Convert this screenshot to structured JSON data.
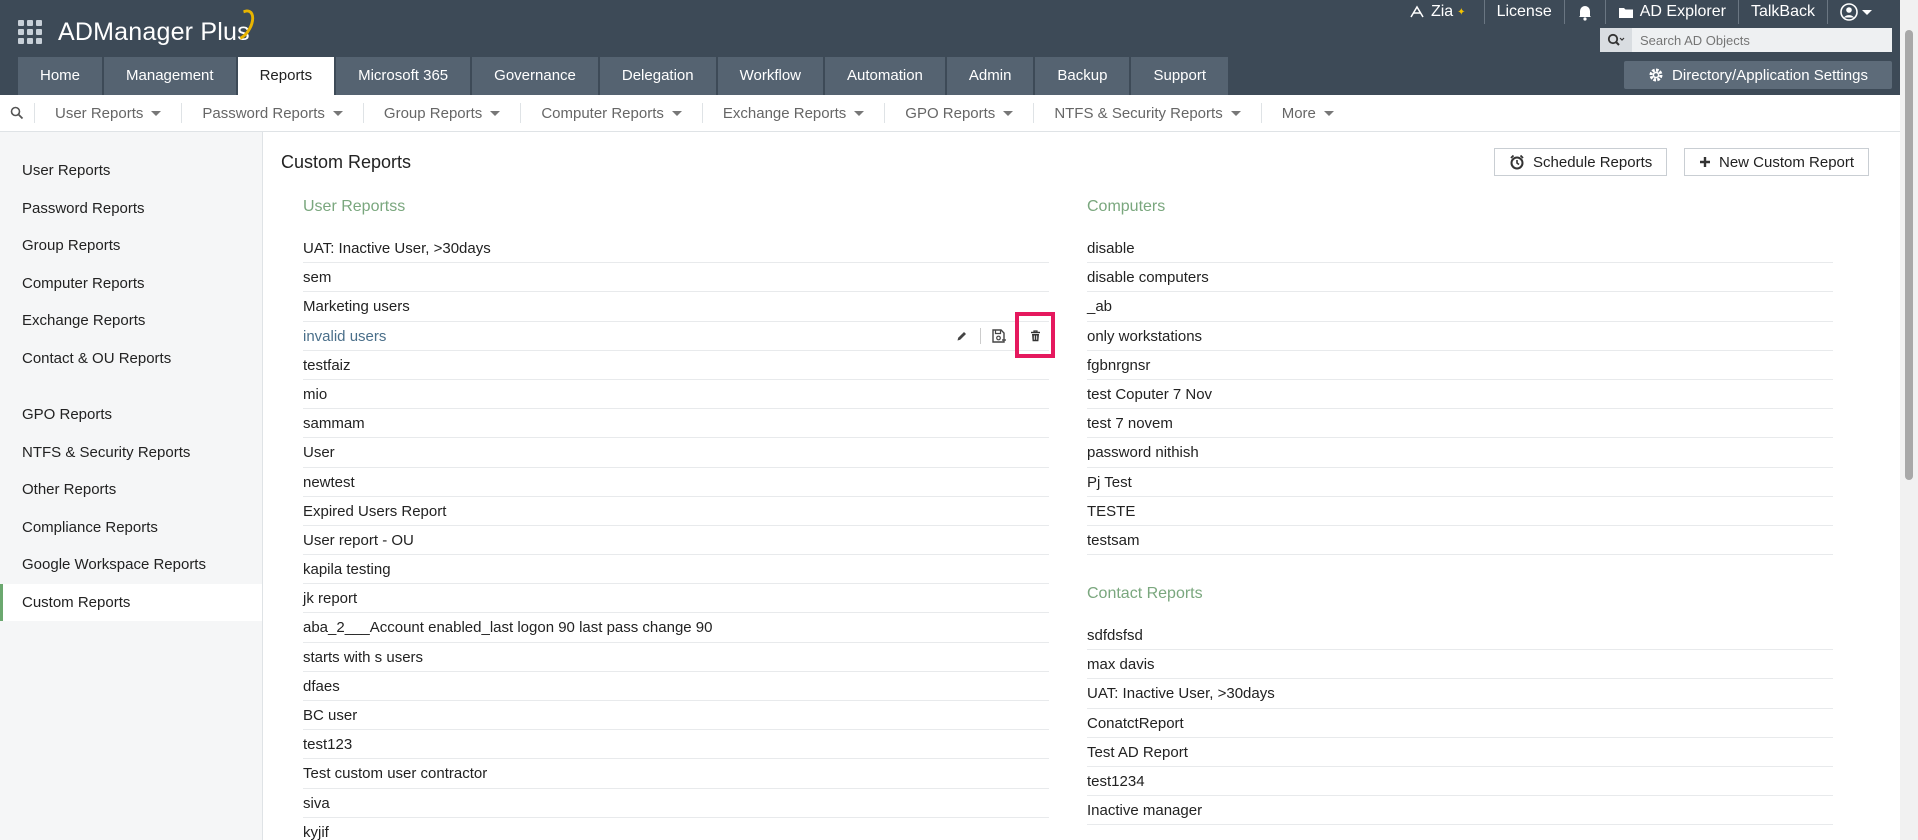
{
  "app": {
    "title": "ADManager Plus"
  },
  "topbar": {
    "zia": "Zia",
    "license": "License",
    "ad_explorer": "AD Explorer",
    "talkback": "TalkBack"
  },
  "search": {
    "placeholder": "Search AD Objects"
  },
  "tabs": [
    {
      "label": "Home"
    },
    {
      "label": "Management"
    },
    {
      "label": "Reports"
    },
    {
      "label": "Microsoft 365"
    },
    {
      "label": "Governance"
    },
    {
      "label": "Delegation"
    },
    {
      "label": "Workflow"
    },
    {
      "label": "Automation"
    },
    {
      "label": "Admin"
    },
    {
      "label": "Backup"
    },
    {
      "label": "Support"
    }
  ],
  "settings_button": "Directory/Application Settings",
  "subnav": [
    {
      "label": "User Reports"
    },
    {
      "label": "Password Reports"
    },
    {
      "label": "Group Reports"
    },
    {
      "label": "Computer Reports"
    },
    {
      "label": "Exchange Reports"
    },
    {
      "label": "GPO Reports"
    },
    {
      "label": "NTFS & Security Reports"
    },
    {
      "label": "More"
    }
  ],
  "sidebar": {
    "group1": [
      {
        "label": "User Reports"
      },
      {
        "label": "Password Reports"
      },
      {
        "label": "Group Reports"
      },
      {
        "label": "Computer Reports"
      },
      {
        "label": "Exchange Reports"
      },
      {
        "label": "Contact & OU Reports"
      }
    ],
    "group2": [
      {
        "label": "GPO Reports"
      },
      {
        "label": "NTFS & Security Reports"
      },
      {
        "label": "Other Reports"
      },
      {
        "label": "Compliance Reports"
      },
      {
        "label": "Google Workspace Reports"
      },
      {
        "label": "Custom Reports"
      }
    ]
  },
  "main": {
    "title": "Custom Reports",
    "schedule_button": "Schedule Reports",
    "new_button": "New Custom Report"
  },
  "user_reports": {
    "title": "User Reportss",
    "items": [
      "UAT: Inactive User, >30days",
      "sem",
      "Marketing users",
      "invalid users",
      "testfaiz",
      "mio",
      "sammam",
      "User",
      "newtest",
      "Expired Users Report",
      "User report - OU",
      "kapila testing",
      "jk report",
      "aba_2___Account enabled_last logon 90 last pass change 90",
      "starts with s users",
      "dfaes",
      "BC user",
      "test123",
      "Test custom user contractor",
      "siva",
      "kyjif"
    ]
  },
  "computers": {
    "title": "Computers",
    "items": [
      "disable",
      "disable computers",
      "_ab",
      "only workstations",
      "fgbnrgnsr",
      "test Coputer 7 Nov",
      "test 7 novem",
      "password nithish",
      "Pj Test",
      "TESTE",
      "testsam"
    ]
  },
  "contacts": {
    "title": "Contact Reports",
    "items": [
      "sdfdsfsd",
      "max davis",
      "UAT: Inactive User, >30days",
      "ConatctReport",
      "Test AD Report",
      "test1234",
      "Inactive manager"
    ]
  }
}
